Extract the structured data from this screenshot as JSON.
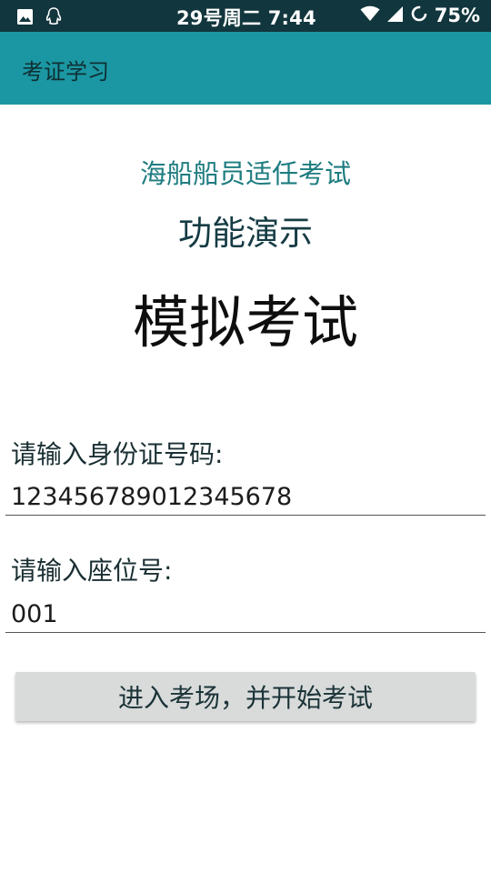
{
  "status_bar": {
    "time": "29号周二 7:44",
    "battery": "75%",
    "icons": [
      "image-icon",
      "qq-icon",
      "wifi-icon",
      "cellular-signal-icon",
      "sync-icon"
    ]
  },
  "app_bar": {
    "title": "考证学习"
  },
  "main": {
    "subtitle": "海船船员适任考试",
    "demo_title": "功能演示",
    "title": "模拟考试"
  },
  "form": {
    "id_label": "请输入身份证号码:",
    "id_value": "123456789012345678",
    "seat_label": "请输入座位号:",
    "seat_value": "001",
    "submit_label": "进入考场，并开始考试"
  },
  "colors": {
    "status_bar": "#12363d",
    "app_bar": "#1b97a3",
    "subtitle": "#1e7c80",
    "button": "#d9dbdb"
  }
}
